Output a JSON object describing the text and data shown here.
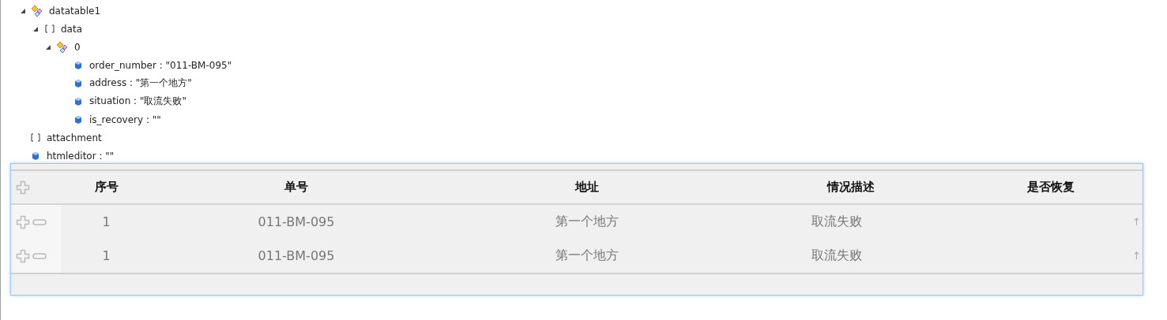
{
  "tree": [
    {
      "kind": "object",
      "label": "datatable1",
      "expanded": true,
      "children": [
        {
          "kind": "array",
          "label": "data",
          "expanded": true,
          "children": [
            {
              "kind": "object",
              "label": "0",
              "expanded": true,
              "children": [
                {
                  "kind": "value",
                  "label": "order_number : \"011-BM-095\""
                },
                {
                  "kind": "value",
                  "label": "address : \"第一个地方\""
                },
                {
                  "kind": "value",
                  "label": "situation : \"取流失败\""
                },
                {
                  "kind": "value",
                  "label": "is_recovery : \"\""
                }
              ]
            }
          ]
        }
      ]
    },
    {
      "kind": "array",
      "label": "attachment"
    },
    {
      "kind": "value",
      "label": "htmleditor : \"\""
    }
  ],
  "grid": {
    "columns": [
      "序号",
      "单号",
      "地址",
      "情况描述",
      "是否恢复"
    ],
    "rows": [
      {
        "cells": [
          "1",
          "011-BM-095",
          "第一个地方",
          "取流失败",
          ""
        ],
        "edge": "↑"
      },
      {
        "cells": [
          "1",
          "011-BM-095",
          "第一个地方",
          "取流失败",
          ""
        ],
        "edge": "↑"
      }
    ]
  }
}
